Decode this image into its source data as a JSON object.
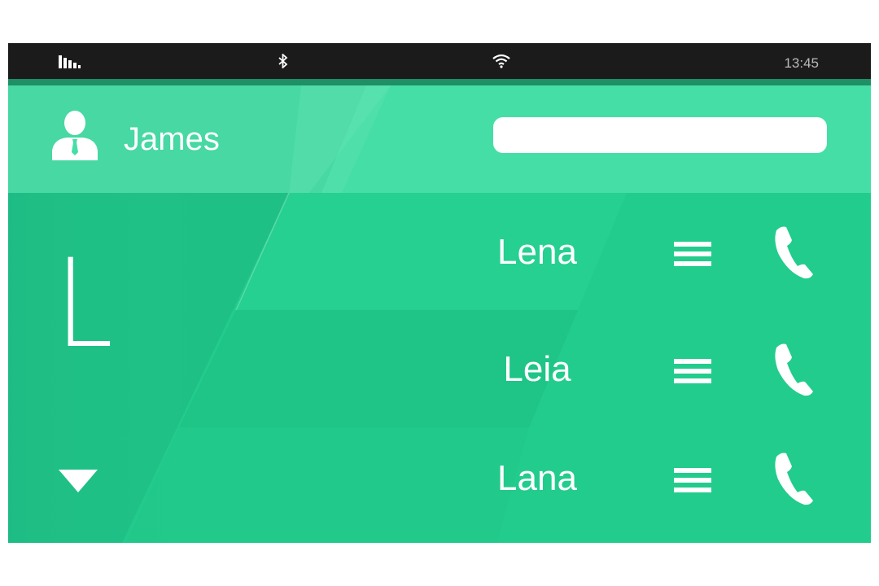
{
  "status_bar": {
    "time": "13:45",
    "icons": [
      "signal-bars-icon",
      "bluetooth-icon",
      "wifi-icon"
    ]
  },
  "header": {
    "user_name": "James",
    "search": {
      "value": "",
      "placeholder": ""
    }
  },
  "index_letter": "L",
  "contacts": [
    {
      "name": "Lena"
    },
    {
      "name": "Leia"
    },
    {
      "name": "Lana"
    }
  ],
  "colors": {
    "background": "#22cc8c",
    "header": "#45dea6",
    "status_bar": "#1b1b1b",
    "status_accent": "#1f8f65",
    "foreground": "#ffffff"
  }
}
